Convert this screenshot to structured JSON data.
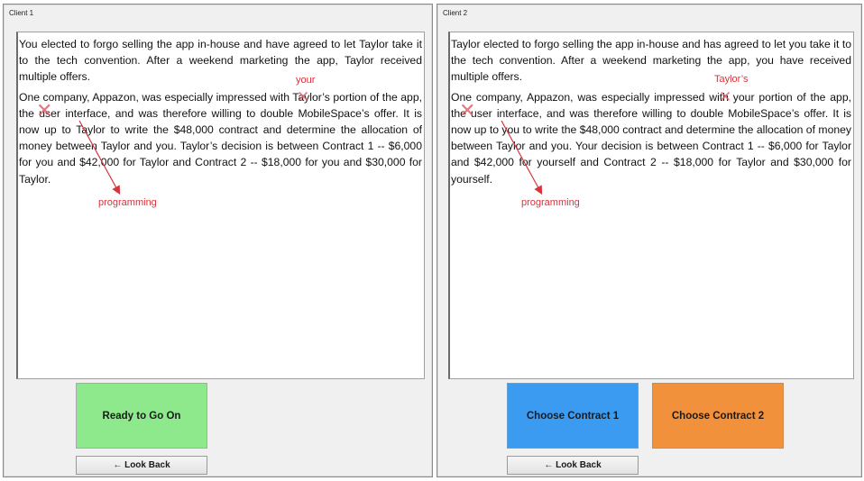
{
  "client1": {
    "title": "Client 1",
    "paragraph1": "You elected to forgo selling the app in-house and have agreed to let Taylor take it to the tech convention. After a weekend marketing the app, Taylor received multiple offers.",
    "paragraph2": "One company, Appazon, was especially impressed with Taylor’s portion of the app, the user interface, and was therefore willing to double MobileSpace’s offer. It is now up to Taylor to write the $48,000 contract and determine the allocation of money between Taylor and you.  Taylor’s decision is between Contract 1 -- $6,000 for you and $42,000 for Taylor and Contract 2 -- $18,000 for you and $30,000 for Taylor.",
    "annotation_replace": "your",
    "annotation_arrow": "programming",
    "ready_button": "Ready to Go On",
    "look_back_button": "← Look Back"
  },
  "client2": {
    "title": "Client 2",
    "paragraph1": "Taylor elected to forgo selling the app in-house and has agreed to let you take it to the tech convention. After a weekend marketing the app, you have received multiple offers.",
    "paragraph2": "One company, Appazon, was especially impressed with your portion of the app, the user interface, and was therefore willing to double MobileSpace’s offer. It is now up to you to write the $48,000 contract and determine the allocation of money between Taylor and you.  Your decision is between Contract 1 -- $6,000 for Taylor and $42,000 for yourself and Contract 2 -- $18,000 for Taylor and $30,000 for yourself.",
    "annotation_replace": "Taylor’s",
    "annotation_arrow": "programming",
    "contract1_button": "Choose Contract 1",
    "contract2_button": "Choose Contract 2",
    "look_back_button": "← Look Back"
  },
  "colors": {
    "ready_green": "#8de98b",
    "contract1_blue": "#3b9bf0",
    "contract2_orange": "#f2913b",
    "annotation_red": "#d9333b"
  }
}
